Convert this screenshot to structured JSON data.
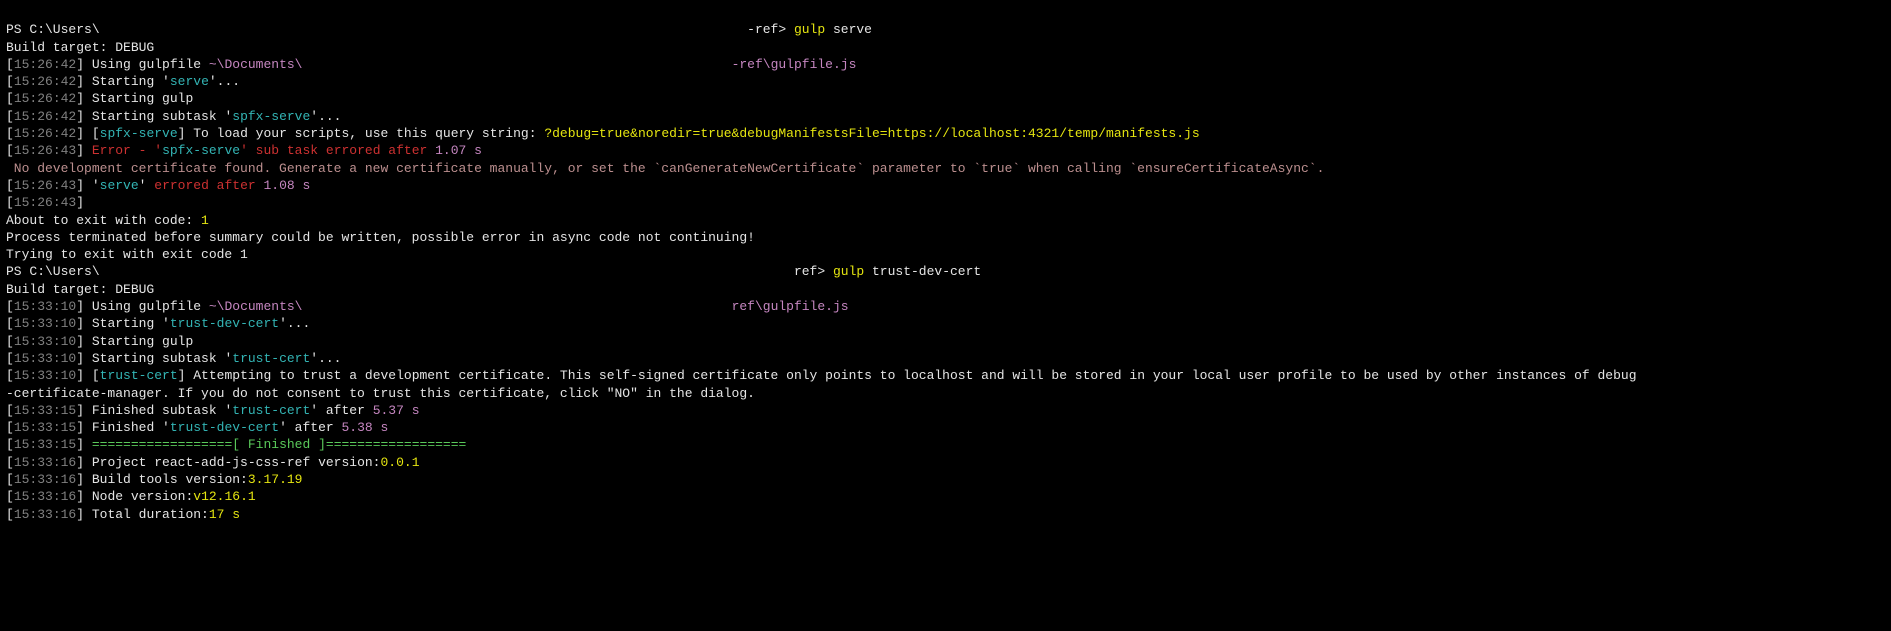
{
  "colors": {
    "bg": "#000000",
    "default": "#cccccc",
    "gray": "#808080",
    "white": "#e5e5e5",
    "yellow": "#e5e510",
    "green": "#5ac95a",
    "magenta": "#c586c0",
    "cyan": "#33b4b4",
    "red": "#cd3131",
    "salmon": "#bc8f8f"
  },
  "lines": [
    [
      {
        "t": "PS C:\\Users\\",
        "c": "white"
      },
      {
        "t": "                                                                                   ",
        "c": "redacted"
      },
      {
        "t": "-ref> ",
        "c": "white"
      },
      {
        "t": "gulp",
        "c": "yellow"
      },
      {
        "t": " serve",
        "c": "white"
      }
    ],
    [
      {
        "t": "Build target: DEBUG",
        "c": "white"
      }
    ],
    [
      {
        "t": "[",
        "c": "white"
      },
      {
        "t": "15:26:42",
        "c": "gray"
      },
      {
        "t": "] Using gulpfile ",
        "c": "white"
      },
      {
        "t": "~\\Documents\\",
        "c": "magenta"
      },
      {
        "t": "                                                       ",
        "c": "redacted"
      },
      {
        "t": "-ref\\gulpfile.js",
        "c": "magenta"
      }
    ],
    [
      {
        "t": "[",
        "c": "white"
      },
      {
        "t": "15:26:42",
        "c": "gray"
      },
      {
        "t": "] Starting '",
        "c": "white"
      },
      {
        "t": "serve",
        "c": "cyan"
      },
      {
        "t": "'...",
        "c": "white"
      }
    ],
    [
      {
        "t": "[",
        "c": "white"
      },
      {
        "t": "15:26:42",
        "c": "gray"
      },
      {
        "t": "] Starting gulp",
        "c": "white"
      }
    ],
    [
      {
        "t": "[",
        "c": "white"
      },
      {
        "t": "15:26:42",
        "c": "gray"
      },
      {
        "t": "] Starting subtask '",
        "c": "white"
      },
      {
        "t": "spfx-serve",
        "c": "cyan"
      },
      {
        "t": "'...",
        "c": "white"
      }
    ],
    [
      {
        "t": "[",
        "c": "white"
      },
      {
        "t": "15:26:42",
        "c": "gray"
      },
      {
        "t": "] [",
        "c": "white"
      },
      {
        "t": "spfx-serve",
        "c": "cyan"
      },
      {
        "t": "] To load your scripts, use this query string: ",
        "c": "white"
      },
      {
        "t": "?debug=true&noredir=true&debugManifestsFile=https://localhost:4321/temp/manifests.js",
        "c": "yellow"
      }
    ],
    [
      {
        "t": "[",
        "c": "white"
      },
      {
        "t": "15:26:43",
        "c": "gray"
      },
      {
        "t": "] ",
        "c": "white"
      },
      {
        "t": "Error - '",
        "c": "red"
      },
      {
        "t": "spfx-serve",
        "c": "cyan"
      },
      {
        "t": "' sub task errored after ",
        "c": "red"
      },
      {
        "t": "1.07 s",
        "c": "magenta"
      }
    ],
    [
      {
        "t": " No development certificate found. Generate a new certificate manually, or set the `canGenerateNewCertificate` parameter to `true` when calling `ensureCertificateAsync`.",
        "c": "salmon"
      }
    ],
    [
      {
        "t": "[",
        "c": "white"
      },
      {
        "t": "15:26:43",
        "c": "gray"
      },
      {
        "t": "] '",
        "c": "white"
      },
      {
        "t": "serve",
        "c": "cyan"
      },
      {
        "t": "' ",
        "c": "white"
      },
      {
        "t": "errored after",
        "c": "red"
      },
      {
        "t": " ",
        "c": "white"
      },
      {
        "t": "1.08 s",
        "c": "magenta"
      }
    ],
    [
      {
        "t": "[",
        "c": "white"
      },
      {
        "t": "15:26:43",
        "c": "gray"
      },
      {
        "t": "]",
        "c": "white"
      }
    ],
    [
      {
        "t": "About to exit with code: ",
        "c": "white"
      },
      {
        "t": "1",
        "c": "yellow"
      }
    ],
    [
      {
        "t": "Process terminated before summary could be written, possible error in async code not continuing!",
        "c": "white"
      }
    ],
    [
      {
        "t": "Trying to exit with exit code 1",
        "c": "white"
      }
    ],
    [
      {
        "t": "PS C:\\Users\\",
        "c": "white"
      },
      {
        "t": "                                                                                         ",
        "c": "redacted"
      },
      {
        "t": "ref> ",
        "c": "white"
      },
      {
        "t": "gulp",
        "c": "yellow"
      },
      {
        "t": " trust-dev-cert",
        "c": "white"
      }
    ],
    [
      {
        "t": "Build target: DEBUG",
        "c": "white"
      }
    ],
    [
      {
        "t": "[",
        "c": "white"
      },
      {
        "t": "15:33:10",
        "c": "gray"
      },
      {
        "t": "] Using gulpfile ",
        "c": "white"
      },
      {
        "t": "~\\Documents\\",
        "c": "magenta"
      },
      {
        "t": "                                                       ",
        "c": "redacted"
      },
      {
        "t": "ref\\gulpfile.js",
        "c": "magenta"
      }
    ],
    [
      {
        "t": "[",
        "c": "white"
      },
      {
        "t": "15:33:10",
        "c": "gray"
      },
      {
        "t": "] Starting '",
        "c": "white"
      },
      {
        "t": "trust-dev-cert",
        "c": "cyan"
      },
      {
        "t": "'...",
        "c": "white"
      }
    ],
    [
      {
        "t": "[",
        "c": "white"
      },
      {
        "t": "15:33:10",
        "c": "gray"
      },
      {
        "t": "] Starting gulp",
        "c": "white"
      }
    ],
    [
      {
        "t": "[",
        "c": "white"
      },
      {
        "t": "15:33:10",
        "c": "gray"
      },
      {
        "t": "] Starting subtask '",
        "c": "white"
      },
      {
        "t": "trust-cert",
        "c": "cyan"
      },
      {
        "t": "'...",
        "c": "white"
      }
    ],
    [
      {
        "t": "[",
        "c": "white"
      },
      {
        "t": "15:33:10",
        "c": "gray"
      },
      {
        "t": "] [",
        "c": "white"
      },
      {
        "t": "trust-cert",
        "c": "cyan"
      },
      {
        "t": "] Attempting to trust a development certificate. This self-signed certificate only points to localhost and will be stored in your local user profile to be used by other instances of debug",
        "c": "white"
      }
    ],
    [
      {
        "t": "-certificate-manager. If you do not consent to trust this certificate, click \"NO\" in the dialog.",
        "c": "white"
      }
    ],
    [
      {
        "t": "[",
        "c": "white"
      },
      {
        "t": "15:33:15",
        "c": "gray"
      },
      {
        "t": "] Finished subtask '",
        "c": "white"
      },
      {
        "t": "trust-cert",
        "c": "cyan"
      },
      {
        "t": "' after ",
        "c": "white"
      },
      {
        "t": "5.37 s",
        "c": "magenta"
      }
    ],
    [
      {
        "t": "[",
        "c": "white"
      },
      {
        "t": "15:33:15",
        "c": "gray"
      },
      {
        "t": "] Finished '",
        "c": "white"
      },
      {
        "t": "trust-dev-cert",
        "c": "cyan"
      },
      {
        "t": "' after ",
        "c": "white"
      },
      {
        "t": "5.38 s",
        "c": "magenta"
      }
    ],
    [
      {
        "t": "[",
        "c": "white"
      },
      {
        "t": "15:33:15",
        "c": "gray"
      },
      {
        "t": "] ",
        "c": "white"
      },
      {
        "t": "==================[ ",
        "c": "green"
      },
      {
        "t": "Finished",
        "c": "green"
      },
      {
        "t": " ]==================",
        "c": "green"
      }
    ],
    [
      {
        "t": "[",
        "c": "white"
      },
      {
        "t": "15:33:16",
        "c": "gray"
      },
      {
        "t": "] Project react-add-js-css-ref version:",
        "c": "white"
      },
      {
        "t": "0.0.1",
        "c": "yellow"
      }
    ],
    [
      {
        "t": "[",
        "c": "white"
      },
      {
        "t": "15:33:16",
        "c": "gray"
      },
      {
        "t": "] Build tools version:",
        "c": "white"
      },
      {
        "t": "3.17.19",
        "c": "yellow"
      }
    ],
    [
      {
        "t": "[",
        "c": "white"
      },
      {
        "t": "15:33:16",
        "c": "gray"
      },
      {
        "t": "] Node version:",
        "c": "white"
      },
      {
        "t": "v12.16.1",
        "c": "yellow"
      }
    ],
    [
      {
        "t": "[",
        "c": "white"
      },
      {
        "t": "15:33:16",
        "c": "gray"
      },
      {
        "t": "] Total duration:",
        "c": "white"
      },
      {
        "t": "17 s",
        "c": "yellow"
      }
    ]
  ]
}
